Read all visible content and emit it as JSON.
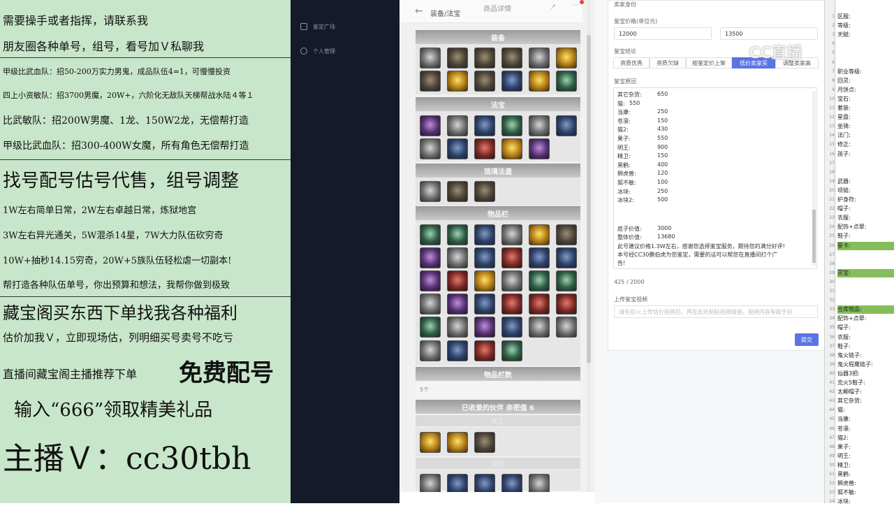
{
  "promo": {
    "lines": [
      "需要操手或者指挥，请联系我",
      "朋友圈各种单号，组号，看号加Ｖ私聊我",
      "甲级比武血队：招50-200万实力男鬼，成品队伍4=1，可慢慢投资",
      "四上小资敏队：招3700男魔，20W+，六阶化无敌队天梯帮战水陆４等１",
      "比武敏队：招200W男魔、1龙、150W2龙，无偿帮打造",
      "甲级比武血队：招300-400W女魔，所有角色无偿帮打造",
      "找号配号估号代售，组号调整",
      "1W左右简单日常，2W左右卓越日常，炼狱地宫",
      "3W左右异光通关，5W混杀14星，7W大力队伍砍穷奇",
      "10W+抽秒14.15穷奇，20W+5族队伍轻松虐一切副本!",
      "帮打造各种队伍单号，你出预算和想法，我帮你做到极致",
      "藏宝阁买东西下单找我各种福利",
      "估价加我Ｖ，立即现场估，列明细买号卖号不吃亏",
      "直播间藏宝阁主播推荐下单",
      "免费配号",
      "输入“666”领取精美礼品",
      "主播Ｖ：cc30tbh"
    ]
  },
  "sidebar": {
    "items": [
      "鉴定广场",
      "个人管理"
    ]
  },
  "phone": {
    "back_label": "装备/法宝",
    "title": "商品详情",
    "sections": {
      "equipment": "装备",
      "fabao": "法宝",
      "shentuzhang": "琉璃法盏",
      "inventory": "物品栏",
      "inv_count_title": "物品栏数",
      "inv_count_value": "5个",
      "unlocked": "已收录的伙伴  亲密值 6",
      "sub1": "天王",
      "sub2": "掌控"
    }
  },
  "form": {
    "section_title": "卖家身份",
    "price_label": "鉴宝价格(单位元)",
    "price_min": "12000",
    "price_max": "13500",
    "conclusion_label": "鉴宝结论",
    "conclusion_options": [
      "资质优秀",
      "资质欠缺",
      "按鉴定价上架",
      "低价卖家买",
      "调整卖家高"
    ],
    "conclusion_active": 3,
    "reason_label": "鉴宝原因",
    "reason_rows": [
      {
        "k": "其它杂货:",
        "v": "650"
      },
      {
        "k": "猫:",
        "v": "550"
      },
      {
        "k": "当康:",
        "v": "250"
      },
      {
        "k": "苍凛:",
        "v": "150"
      },
      {
        "k": "猫2:",
        "v": "430"
      },
      {
        "k": "果子:",
        "v": "550"
      },
      {
        "k": "明王:",
        "v": "900"
      },
      {
        "k": "精卫:",
        "v": "150"
      },
      {
        "k": "黑鹤:",
        "v": "400"
      },
      {
        "k": "狮虎兽:",
        "v": "120"
      },
      {
        "k": "狐不敏:",
        "v": "100"
      },
      {
        "k": "冰块:",
        "v": "250"
      },
      {
        "k": "冰块2:",
        "v": "500"
      }
    ],
    "base_value_label": "底子价值:",
    "base_value": "3000",
    "total_value_label": "整体价值:",
    "total_value": "13680",
    "comment_line1": "此号建议价格1.3W左右，感谢您选择鉴宝服务，期待您的满分好评!",
    "comment_line2": "本号经CC30鹏伯虎为您鉴定，需要的话可以帮您在直播间打个广",
    "comment_line3": "告!",
    "char_count": "425 / 2000",
    "upload_label": "上传鉴宝视频",
    "upload_placeholder": "请先在cc上传估价视频后，再在此处粘贴视频链接，视频内容有助于好",
    "submit_label": "提交"
  },
  "sheet": {
    "rows": [
      {
        "n": "1",
        "t": "区服:"
      },
      {
        "n": "2",
        "t": "等级:"
      },
      {
        "n": "3",
        "t": "天赋:"
      },
      {
        "n": "4",
        "t": ""
      },
      {
        "n": "5",
        "t": ""
      },
      {
        "n": "6",
        "t": ""
      },
      {
        "n": "7",
        "t": "职业等级:"
      },
      {
        "n": "8",
        "t": "回灵:"
      },
      {
        "n": "9",
        "t": "月饼点:"
      },
      {
        "n": "10",
        "t": "宝石:"
      },
      {
        "n": "11",
        "t": "套装:"
      },
      {
        "n": "12",
        "t": "星盘:"
      },
      {
        "n": "13",
        "t": "坐骑:"
      },
      {
        "n": "14",
        "t": "法门:"
      },
      {
        "n": "15",
        "t": "修正:"
      },
      {
        "n": "16",
        "t": "孩子:"
      },
      {
        "n": "17",
        "t": ""
      },
      {
        "n": "18",
        "t": ""
      },
      {
        "n": "19",
        "t": "武器:"
      },
      {
        "n": "20",
        "t": "项链:"
      },
      {
        "n": "21",
        "t": "护身符:"
      },
      {
        "n": "22",
        "t": "帽子:"
      },
      {
        "n": "23",
        "t": "衣服:"
      },
      {
        "n": "24",
        "t": "配饰+点翠:"
      },
      {
        "n": "25",
        "t": "鞋子:"
      },
      {
        "n": "26",
        "t": "星卡:"
      },
      {
        "n": "27",
        "t": ""
      },
      {
        "n": "28",
        "t": ""
      },
      {
        "n": "29",
        "t": "灵宝:"
      },
      {
        "n": "30",
        "t": ""
      },
      {
        "n": "31",
        "t": ""
      },
      {
        "n": "32",
        "t": ""
      },
      {
        "n": "33",
        "t": "仓库物品:"
      },
      {
        "n": "34",
        "t": "配饰+点翠:"
      },
      {
        "n": "35",
        "t": "帽子:"
      },
      {
        "n": "36",
        "t": "衣服:"
      },
      {
        "n": "37",
        "t": "鞋子:"
      },
      {
        "n": "38",
        "t": "鬼火链子:"
      },
      {
        "n": "39",
        "t": "鬼火程鹰链子:"
      },
      {
        "n": "40",
        "t": "仙器3把:"
      },
      {
        "n": "41",
        "t": "克火5鞋子:"
      },
      {
        "n": "42",
        "t": "太颠帽子:"
      },
      {
        "n": "43",
        "t": "其它杂货:"
      },
      {
        "n": "44",
        "t": "猫:"
      },
      {
        "n": "45",
        "t": "当康:"
      },
      {
        "n": "46",
        "t": "苍凛:"
      },
      {
        "n": "47",
        "t": "猫2:"
      },
      {
        "n": "48",
        "t": "果子:"
      },
      {
        "n": "49",
        "t": "明王:"
      },
      {
        "n": "50",
        "t": "精卫:"
      },
      {
        "n": "51",
        "t": "黑鹤:"
      },
      {
        "n": "52",
        "t": "狮虎兽:"
      },
      {
        "n": "53",
        "t": "狐不敏:"
      },
      {
        "n": "54",
        "t": "冰块:"
      }
    ],
    "highlight_rows": [
      25,
      28,
      32
    ]
  },
  "watermark": "CC直播",
  "colors": {
    "promo_bg": "#c8e6c9",
    "sidebar_bg": "#141a29",
    "primary": "#5b74e3",
    "sheet_highlight": "#86bd5b"
  }
}
